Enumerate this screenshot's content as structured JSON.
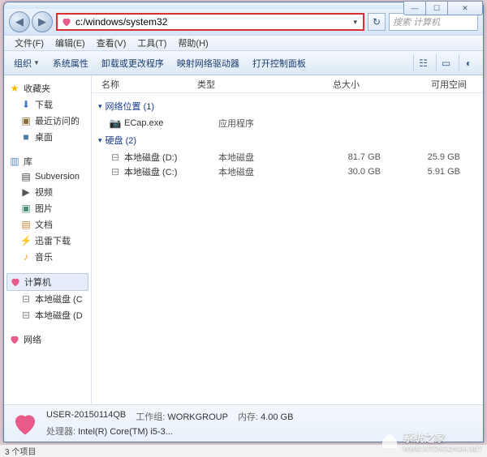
{
  "window_controls": {
    "min": "—",
    "max": "☐",
    "close": "✕"
  },
  "address": {
    "value": "c:/windows/system32",
    "dropdown": "▾"
  },
  "nav": {
    "back": "◀",
    "forward": "▶",
    "refresh": "↻"
  },
  "search": {
    "placeholder": "搜索 计算机"
  },
  "menubar": [
    "文件(F)",
    "编辑(E)",
    "查看(V)",
    "工具(T)",
    "帮助(H)"
  ],
  "toolbar": {
    "organize": "组织",
    "props": "系统属性",
    "uninstall": "卸载或更改程序",
    "netdrive": "映射网络驱动器",
    "ctrlpanel": "打开控制面板"
  },
  "sidebar": {
    "favorites": {
      "label": "收藏夹",
      "items": [
        "下载",
        "最近访问的",
        "桌面"
      ]
    },
    "libraries": {
      "label": "库",
      "items": [
        "Subversion",
        "视频",
        "图片",
        "文档",
        "迅雷下载",
        "音乐"
      ]
    },
    "computer": {
      "label": "计算机",
      "items": [
        "本地磁盘 (C",
        "本地磁盘 (D"
      ]
    },
    "network": {
      "label": "网络"
    }
  },
  "columns": {
    "name": "名称",
    "type": "类型",
    "totalsize": "总大小",
    "free": "可用空间"
  },
  "groups": {
    "netloc": {
      "label": "网络位置 (1)",
      "items": [
        {
          "name": "ECap.exe",
          "type": "应用程序",
          "size": "",
          "free": "",
          "icon": "camera"
        }
      ]
    },
    "harddisk": {
      "label": "硬盘 (2)",
      "items": [
        {
          "name": "本地磁盘 (D:)",
          "type": "本地磁盘",
          "size": "81.7 GB",
          "free": "25.9 GB",
          "icon": "disk"
        },
        {
          "name": "本地磁盘 (C:)",
          "type": "本地磁盘",
          "size": "30.0 GB",
          "free": "5.91 GB",
          "icon": "disk"
        }
      ]
    }
  },
  "details": {
    "name": "USER-20150114QB",
    "workgroup_lbl": "工作组:",
    "workgroup": "WORKGROUP",
    "mem_lbl": "内存:",
    "mem": "4.00 GB",
    "cpu_lbl": "处理器:",
    "cpu": "Intel(R) Core(TM) i5-3..."
  },
  "status": "3 个项目",
  "watermark": {
    "text1": "系统之家",
    "text2": "WWW.XITONGZHIJIA.NET"
  }
}
